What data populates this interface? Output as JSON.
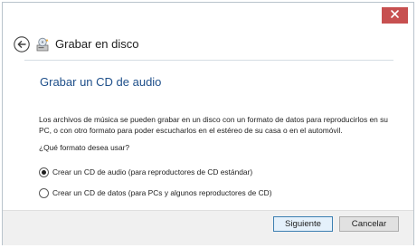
{
  "window": {
    "title": "Grabar en disco",
    "close_icon": "close-icon",
    "back_icon": "back-arrow-icon",
    "app_icon": "burn-disc-icon",
    "close_color": "#c75050"
  },
  "wizard": {
    "heading": "Grabar un CD de audio",
    "description": "Los archivos de música se pueden grabar en un disco con un formato de datos para reproducirlos en su PC, o con otro formato para poder escucharlos en el estéreo de su casa o en el automóvil.",
    "question": "¿Qué formato desea usar?",
    "options": [
      {
        "label": "Crear un CD de audio (para reproductores de CD estándar)",
        "selected": true
      },
      {
        "label": "Crear un CD de datos (para PCs y algunos reproductores de CD)",
        "selected": false
      }
    ]
  },
  "buttons": {
    "next_label": "Siguiente",
    "cancel_label": "Cancelar"
  },
  "colors": {
    "heading": "#1e4f8a",
    "primary_button_border": "#3c7fb1"
  }
}
